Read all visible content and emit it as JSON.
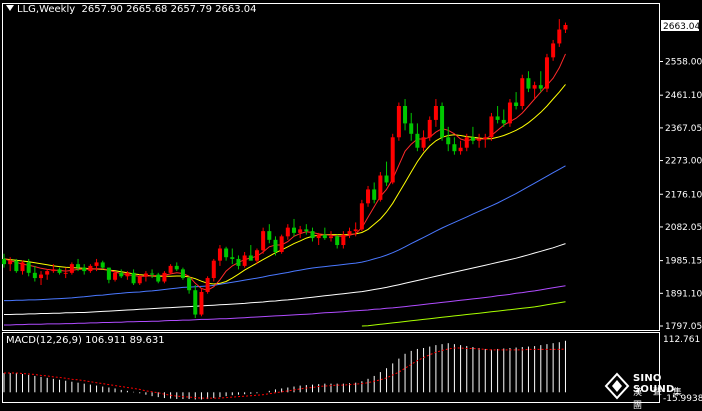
{
  "header": {
    "symbol_label": "LLG,Weekly",
    "ohlc": "2657.90 2665.68 2657.79 2663.04"
  },
  "current_price": "2663.04",
  "macd": {
    "label": "MACD(12,26,9) 106.911 89.631",
    "scale_top": "112.761",
    "scale_bottom": "-15.9938"
  },
  "brand": {
    "name": "SINO SOUND",
    "subtitle": "漢 聲 集 團"
  },
  "colors": {
    "bull": "#ff0000",
    "bear": "#00c800",
    "ma_red": "#ff2a2a",
    "ma_yellow": "#ffff00",
    "ma_blue": "#4a78ff",
    "ma_white": "#ffffff",
    "ma_purple": "#b04cff",
    "ma_green": "#a8ff00",
    "macd_bar": "#ffffff",
    "macd_signal": "#ff0000"
  },
  "chart_data": {
    "type": "candlestick",
    "y_ticks": [
      "2663.04",
      "2558.00",
      "2461.10",
      "2367.05",
      "2273.00",
      "2176.10",
      "2082.05",
      "1985.15",
      "1891.10",
      "1797.05"
    ],
    "ylim": [
      1797.05,
      2663.04
    ],
    "candles": [
      [
        1990,
        2005,
        1965,
        1975
      ],
      [
        1975,
        1995,
        1955,
        1985
      ],
      [
        1985,
        1990,
        1950,
        1955
      ],
      [
        1955,
        1985,
        1945,
        1980
      ],
      [
        1980,
        1990,
        1940,
        1950
      ],
      [
        1950,
        1970,
        1925,
        1935
      ],
      [
        1935,
        1955,
        1915,
        1945
      ],
      [
        1945,
        1960,
        1930,
        1955
      ],
      [
        1955,
        1975,
        1950,
        1960
      ],
      [
        1960,
        1965,
        1945,
        1950
      ],
      [
        1950,
        1965,
        1935,
        1950
      ],
      [
        1950,
        1980,
        1945,
        1975
      ],
      [
        1975,
        1990,
        1955,
        1965
      ],
      [
        1965,
        1975,
        1945,
        1955
      ],
      [
        1955,
        1975,
        1950,
        1970
      ],
      [
        1970,
        1990,
        1955,
        1980
      ],
      [
        1980,
        1985,
        1960,
        1965
      ],
      [
        1965,
        1965,
        1920,
        1930
      ],
      [
        1930,
        1955,
        1925,
        1950
      ],
      [
        1950,
        1960,
        1935,
        1940
      ],
      [
        1940,
        1955,
        1930,
        1950
      ],
      [
        1950,
        1960,
        1915,
        1920
      ],
      [
        1920,
        1945,
        1915,
        1940
      ],
      [
        1940,
        1955,
        1925,
        1948
      ],
      [
        1948,
        1960,
        1935,
        1945
      ],
      [
        1945,
        1950,
        1920,
        1925
      ],
      [
        1925,
        1955,
        1920,
        1950
      ],
      [
        1950,
        1975,
        1945,
        1970
      ],
      [
        1970,
        1980,
        1955,
        1960
      ],
      [
        1960,
        1965,
        1930,
        1935
      ],
      [
        1935,
        1940,
        1890,
        1900
      ],
      [
        1900,
        1915,
        1820,
        1830
      ],
      [
        1830,
        1905,
        1825,
        1895
      ],
      [
        1895,
        1940,
        1890,
        1935
      ],
      [
        1935,
        1990,
        1925,
        1985
      ],
      [
        1985,
        2030,
        1970,
        2020
      ],
      [
        2020,
        2025,
        1985,
        1995
      ],
      [
        1995,
        2020,
        1975,
        1990
      ],
      [
        1990,
        2000,
        1960,
        1970
      ],
      [
        1970,
        2010,
        1965,
        2000
      ],
      [
        2000,
        2030,
        1990,
        1985
      ],
      [
        1985,
        2020,
        1975,
        2015
      ],
      [
        2015,
        2080,
        2005,
        2070
      ],
      [
        2070,
        2090,
        2035,
        2045
      ],
      [
        2045,
        2055,
        2000,
        2010
      ],
      [
        2010,
        2060,
        2005,
        2055
      ],
      [
        2055,
        2090,
        2045,
        2080
      ],
      [
        2080,
        2105,
        2055,
        2065
      ],
      [
        2065,
        2085,
        2050,
        2075
      ],
      [
        2075,
        2090,
        2060,
        2070
      ],
      [
        2070,
        2080,
        2040,
        2050
      ],
      [
        2050,
        2065,
        2030,
        2060
      ],
      [
        2060,
        2080,
        2045,
        2050
      ],
      [
        2050,
        2070,
        2040,
        2055
      ],
      [
        2055,
        2060,
        2020,
        2030
      ],
      [
        2030,
        2070,
        2020,
        2060
      ],
      [
        2060,
        2080,
        2050,
        2070
      ],
      [
        2070,
        2095,
        2055,
        2075
      ],
      [
        2075,
        2160,
        2070,
        2150
      ],
      [
        2150,
        2200,
        2140,
        2190
      ],
      [
        2190,
        2210,
        2150,
        2160
      ],
      [
        2160,
        2240,
        2155,
        2230
      ],
      [
        2230,
        2270,
        2200,
        2210
      ],
      [
        2210,
        2350,
        2205,
        2340
      ],
      [
        2340,
        2440,
        2330,
        2430
      ],
      [
        2430,
        2450,
        2360,
        2380
      ],
      [
        2380,
        2410,
        2330,
        2350
      ],
      [
        2350,
        2380,
        2300,
        2310
      ],
      [
        2310,
        2360,
        2300,
        2340
      ],
      [
        2340,
        2400,
        2330,
        2390
      ],
      [
        2390,
        2450,
        2370,
        2430
      ],
      [
        2430,
        2440,
        2330,
        2340
      ],
      [
        2340,
        2370,
        2300,
        2320
      ],
      [
        2320,
        2340,
        2290,
        2300
      ],
      [
        2300,
        2330,
        2290,
        2310
      ],
      [
        2310,
        2350,
        2300,
        2340
      ],
      [
        2340,
        2370,
        2320,
        2330
      ],
      [
        2330,
        2350,
        2310,
        2335
      ],
      [
        2335,
        2350,
        2310,
        2340
      ],
      [
        2340,
        2410,
        2330,
        2400
      ],
      [
        2400,
        2430,
        2380,
        2390
      ],
      [
        2390,
        2420,
        2370,
        2380
      ],
      [
        2380,
        2450,
        2370,
        2440
      ],
      [
        2440,
        2470,
        2420,
        2430
      ],
      [
        2430,
        2520,
        2420,
        2510
      ],
      [
        2510,
        2530,
        2470,
        2480
      ],
      [
        2480,
        2500,
        2450,
        2490
      ],
      [
        2490,
        2530,
        2470,
        2480
      ],
      [
        2480,
        2580,
        2470,
        2570
      ],
      [
        2570,
        2620,
        2560,
        2610
      ],
      [
        2610,
        2680,
        2600,
        2650
      ],
      [
        2650,
        2670,
        2640,
        2663
      ]
    ],
    "ma_red": [
      1990,
      1985,
      1980,
      1975,
      1972,
      1968,
      1963,
      1960,
      1958,
      1957,
      1955,
      1957,
      1960,
      1961,
      1960,
      1962,
      1962,
      1958,
      1952,
      1948,
      1945,
      1942,
      1940,
      1940,
      1942,
      1942,
      1943,
      1947,
      1950,
      1948,
      1940,
      1920,
      1905,
      1900,
      1910,
      1930,
      1955,
      1970,
      1980,
      1988,
      1993,
      1998,
      2010,
      2025,
      2030,
      2030,
      2040,
      2055,
      2063,
      2068,
      2066,
      2062,
      2060,
      2058,
      2056,
      2055,
      2058,
      2063,
      2080,
      2110,
      2140,
      2170,
      2190,
      2220,
      2260,
      2300,
      2320,
      2335,
      2335,
      2340,
      2355,
      2365,
      2360,
      2350,
      2335,
      2330,
      2335,
      2335,
      2335,
      2345,
      2360,
      2375,
      2385,
      2395,
      2410,
      2430,
      2450,
      2470,
      2490,
      2510,
      2540,
      2580
    ],
    "ma_yellow": [
      1990,
      1988,
      1986,
      1984,
      1982,
      1979,
      1976,
      1973,
      1970,
      1968,
      1966,
      1965,
      1964,
      1963,
      1962,
      1961,
      1960,
      1958,
      1956,
      1953,
      1950,
      1947,
      1945,
      1943,
      1941,
      1940,
      1940,
      1940,
      1941,
      1941,
      1938,
      1933,
      1926,
      1920,
      1918,
      1920,
      1925,
      1935,
      1946,
      1958,
      1968,
      1978,
      1988,
      1998,
      2008,
      2016,
      2025,
      2034,
      2042,
      2050,
      2055,
      2058,
      2060,
      2060,
      2060,
      2060,
      2060,
      2062,
      2066,
      2075,
      2090,
      2105,
      2125,
      2150,
      2180,
      2210,
      2240,
      2270,
      2295,
      2315,
      2330,
      2340,
      2345,
      2347,
      2345,
      2342,
      2340,
      2338,
      2336,
      2336,
      2340,
      2345,
      2352,
      2360,
      2370,
      2382,
      2396,
      2412,
      2430,
      2450,
      2470,
      2492
    ],
    "ma_blue": [
      1870,
      1870,
      1871,
      1871,
      1872,
      1872,
      1873,
      1874,
      1875,
      1876,
      1877,
      1878,
      1880,
      1881,
      1883,
      1885,
      1886,
      1888,
      1890,
      1891,
      1893,
      1894,
      1895,
      1897,
      1898,
      1900,
      1902,
      1904,
      1906,
      1908,
      1909,
      1910,
      1911,
      1912,
      1914,
      1917,
      1920,
      1923,
      1926,
      1929,
      1932,
      1935,
      1938,
      1942,
      1945,
      1948,
      1951,
      1955,
      1958,
      1961,
      1964,
      1966,
      1968,
      1970,
      1972,
      1974,
      1976,
      1978,
      1981,
      1985,
      1990,
      1995,
      2001,
      2008,
      2016,
      2025,
      2034,
      2043,
      2052,
      2061,
      2070,
      2079,
      2087,
      2095,
      2103,
      2111,
      2119,
      2127,
      2135,
      2143,
      2151,
      2160,
      2169,
      2178,
      2188,
      2198,
      2208,
      2218,
      2228,
      2238,
      2248,
      2258
    ],
    "ma_white": [
      1830,
      1830,
      1831,
      1831,
      1832,
      1832,
      1833,
      1833,
      1834,
      1834,
      1835,
      1835,
      1836,
      1836,
      1837,
      1838,
      1839,
      1840,
      1841,
      1842,
      1843,
      1844,
      1845,
      1846,
      1847,
      1848,
      1849,
      1850,
      1851,
      1852,
      1853,
      1854,
      1855,
      1856,
      1857,
      1858,
      1859,
      1860,
      1861,
      1862,
      1864,
      1865,
      1866,
      1868,
      1869,
      1871,
      1872,
      1874,
      1876,
      1878,
      1880,
      1882,
      1884,
      1886,
      1888,
      1890,
      1892,
      1894,
      1896,
      1899,
      1902,
      1905,
      1908,
      1912,
      1916,
      1920,
      1924,
      1928,
      1932,
      1936,
      1940,
      1944,
      1948,
      1952,
      1956,
      1960,
      1964,
      1968,
      1972,
      1976,
      1980,
      1984,
      1988,
      1992,
      1997,
      2002,
      2007,
      2012,
      2017,
      2022,
      2028,
      2034
    ],
    "ma_purple": [
      1800,
      1800,
      1801,
      1801,
      1802,
      1802,
      1802,
      1803,
      1803,
      1803,
      1804,
      1804,
      1805,
      1805,
      1806,
      1806,
      1807,
      1807,
      1808,
      1808,
      1809,
      1809,
      1810,
      1810,
      1811,
      1811,
      1812,
      1813,
      1813,
      1814,
      1814,
      1815,
      1816,
      1816,
      1817,
      1818,
      1818,
      1819,
      1820,
      1821,
      1822,
      1823,
      1824,
      1825,
      1826,
      1827,
      1828,
      1829,
      1830,
      1831,
      1832,
      1834,
      1835,
      1836,
      1837,
      1838,
      1840,
      1841,
      1842,
      1843,
      1845,
      1846,
      1848,
      1849,
      1851,
      1853,
      1855,
      1857,
      1859,
      1861,
      1863,
      1865,
      1867,
      1869,
      1871,
      1873,
      1875,
      1877,
      1879,
      1881,
      1884,
      1886,
      1888,
      1891,
      1893,
      1896,
      1898,
      1901,
      1904,
      1907,
      1910,
      1913
    ],
    "ma_green": [
      null,
      null,
      null,
      null,
      null,
      null,
      null,
      null,
      null,
      null,
      null,
      null,
      null,
      null,
      null,
      null,
      null,
      null,
      null,
      null,
      null,
      null,
      null,
      null,
      null,
      null,
      null,
      null,
      null,
      null,
      null,
      null,
      null,
      null,
      null,
      null,
      null,
      null,
      null,
      null,
      null,
      null,
      null,
      null,
      null,
      null,
      null,
      null,
      null,
      null,
      null,
      null,
      null,
      null,
      null,
      null,
      null,
      null,
      1797,
      1798,
      1800,
      1802,
      1804,
      1806,
      1808,
      1810,
      1812,
      1814,
      1816,
      1818,
      1820,
      1822,
      1824,
      1826,
      1828,
      1830,
      1832,
      1834,
      1836,
      1838,
      1840,
      1842,
      1844,
      1846,
      1848,
      1850,
      1852,
      1855,
      1858,
      1861,
      1864,
      1867
    ],
    "macd_values": [
      40,
      40,
      40,
      38,
      36,
      34,
      32,
      30,
      28,
      26,
      24,
      22,
      20,
      18,
      16,
      14,
      12,
      10,
      8,
      5,
      3,
      1,
      -2,
      -5,
      -8,
      -10,
      -12,
      -13,
      -14,
      -14,
      -14,
      -15,
      -15,
      -14,
      -12,
      -10,
      -8,
      -6,
      -5,
      -4,
      -3,
      -2,
      0,
      3,
      6,
      8,
      10,
      12,
      14,
      15,
      16,
      17,
      18,
      18,
      18,
      18,
      19,
      20,
      23,
      28,
      34,
      42,
      50,
      60,
      70,
      80,
      86,
      90,
      92,
      95,
      98,
      100,
      102,
      100,
      98,
      96,
      94,
      92,
      90,
      89,
      90,
      91,
      92,
      93,
      94,
      95,
      96,
      98,
      100,
      102,
      104,
      107
    ],
    "macd_signal": [
      40,
      40,
      40,
      39,
      38,
      37,
      35,
      34,
      32,
      31,
      29,
      27,
      26,
      24,
      22,
      20,
      18,
      16,
      14,
      12,
      10,
      8,
      6,
      3,
      1,
      -1,
      -4,
      -6,
      -8,
      -9,
      -10,
      -11,
      -12,
      -12,
      -12,
      -12,
      -11,
      -10,
      -9,
      -8,
      -7,
      -6,
      -5,
      -3,
      -1,
      1,
      3,
      5,
      7,
      9,
      10,
      12,
      13,
      14,
      15,
      15,
      16,
      17,
      18,
      20,
      23,
      26,
      30,
      36,
      42,
      50,
      58,
      66,
      72,
      78,
      83,
      87,
      90,
      92,
      92,
      91,
      91,
      90,
      89,
      88,
      88,
      88,
      88,
      88,
      88,
      89,
      89,
      89,
      89,
      89,
      89,
      90
    ]
  }
}
